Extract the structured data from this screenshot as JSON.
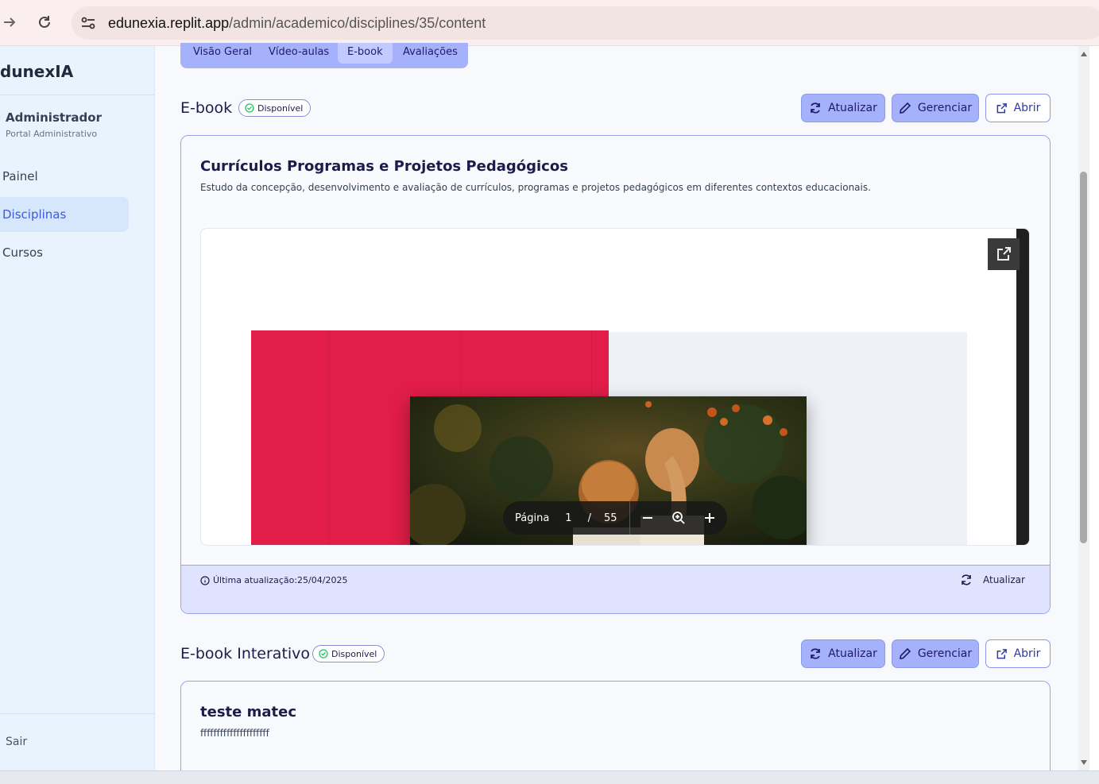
{
  "browser": {
    "url_host": "edunexia.replit.app",
    "url_path": "/admin/academico/disciplines/35/content"
  },
  "sidebar": {
    "brand": "dunexIA",
    "user_name": "Administrador",
    "user_role": "Portal Administrativo",
    "items": [
      {
        "label": "Painel",
        "active": false
      },
      {
        "label": "Disciplinas",
        "active": true
      },
      {
        "label": "Cursos",
        "active": false
      }
    ],
    "logout": "Sair"
  },
  "tabs": [
    {
      "label": "Visão Geral",
      "active": false
    },
    {
      "label": "Vídeo-aulas",
      "active": false
    },
    {
      "label": "E-book",
      "active": true
    },
    {
      "label": "Avaliações",
      "active": false
    }
  ],
  "ebook": {
    "title": "E-book",
    "status": "Disponível",
    "buttons": {
      "update": "Atualizar",
      "manage": "Gerenciar",
      "open": "Abrir"
    },
    "card_title": "Currículos Programas e Projetos Pedagógicos",
    "card_desc": "Estudo da concepção, desenvolvimento e avaliação de currículos, programas e projetos pedagógicos em diferentes contextos educacionais.",
    "viewer": {
      "page_label": "Página",
      "current_page": "1",
      "separator": "/",
      "total_pages": "55"
    },
    "footer": {
      "updated_label": "Última atualização:",
      "updated_date": "25/04/2025",
      "refresh": "Atualizar"
    }
  },
  "interactive": {
    "title": "E-book Interativo",
    "status": "Disponível",
    "buttons": {
      "update": "Atualizar",
      "manage": "Gerenciar",
      "open": "Abrir"
    },
    "card_title": "teste matec",
    "card_desc": "fffffffffffffffffffff"
  },
  "colors": {
    "accent": "#a5b1fb",
    "cover_red": "#e11d48",
    "badge_green": "#22c55e"
  }
}
